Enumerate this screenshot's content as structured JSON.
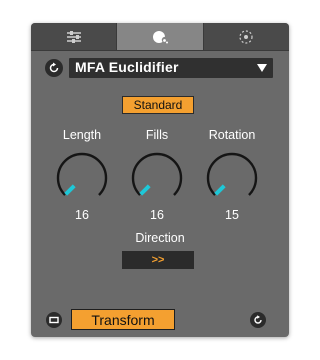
{
  "tabs": [
    {
      "icon": "sliders-icon",
      "active": false
    },
    {
      "icon": "palette-icon",
      "active": true
    },
    {
      "icon": "circle-dots-icon",
      "active": false
    }
  ],
  "device": {
    "name": "MFA Euclidifier"
  },
  "mode": {
    "label": "Standard"
  },
  "knobs": [
    {
      "label": "Length",
      "value": "16",
      "level": 0.0
    },
    {
      "label": "Fills",
      "value": "16",
      "level": 0.0
    },
    {
      "label": "Rotation",
      "value": "15",
      "level": 0.0
    }
  ],
  "direction": {
    "label": "Direction",
    "value": ">>"
  },
  "footer": {
    "transform_label": "Transform"
  },
  "colors": {
    "panel": "#6a6a6a",
    "accent": "#f4a030",
    "knob_indicator": "#1ec8d8",
    "dark": "#2b2b2b"
  }
}
